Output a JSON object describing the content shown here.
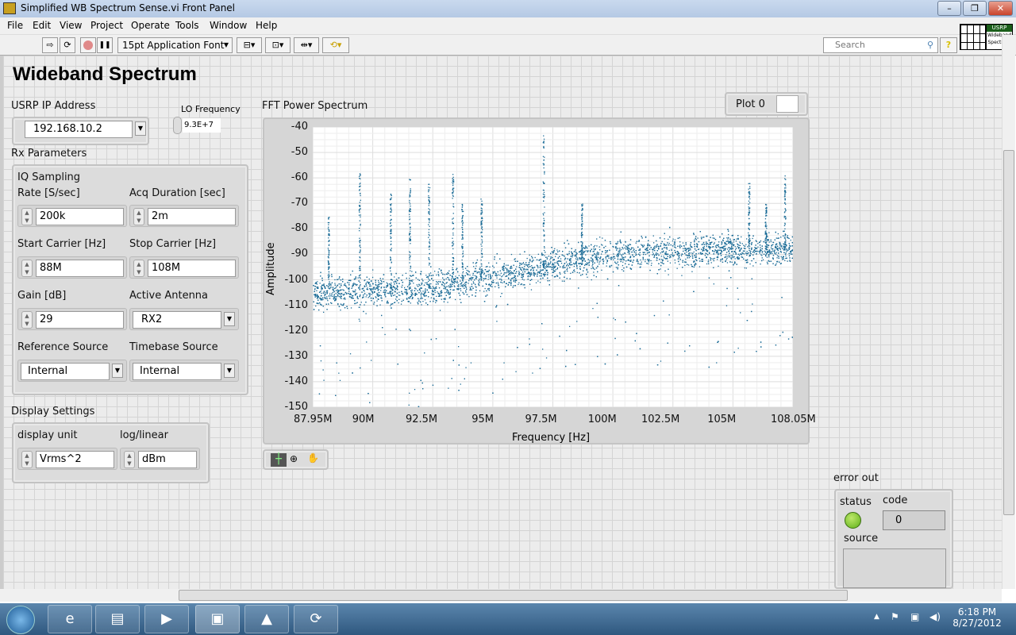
{
  "window": {
    "title": "Simplified WB Spectrum Sense.vi Front Panel",
    "minimize": "–",
    "restore": "❐",
    "close": "✕"
  },
  "menu": [
    "File",
    "Edit",
    "View",
    "Project",
    "Operate",
    "Tools",
    "Window",
    "Help"
  ],
  "toolbar": {
    "font": "15pt Application Font",
    "search_placeholder": "Search"
  },
  "vi_icon": {
    "banner": "USRP",
    "line1": "Wideband",
    "line2": "Spectrum"
  },
  "panel": {
    "title": "Wideband Spectrum",
    "ip": {
      "label": "USRP IP Address",
      "value": "192.168.10.2"
    },
    "lo": {
      "label": "LO Frequency",
      "value": "9.3E+7"
    },
    "rx": {
      "label": "Rx Parameters",
      "iq_label": "IQ Sampling",
      "rate": {
        "label": "Rate [S/sec]",
        "value": "200k"
      },
      "acq": {
        "label": "Acq Duration [sec]",
        "value": "2m"
      },
      "start": {
        "label": "Start Carrier [Hz]",
        "value": "88M"
      },
      "stop": {
        "label": "Stop Carrier [Hz]",
        "value": "108M"
      },
      "gain": {
        "label": "Gain [dB]",
        "value": "29"
      },
      "antenna": {
        "label": "Active Antenna",
        "value": "RX2"
      },
      "ref": {
        "label": "Reference Source",
        "value": "Internal"
      },
      "timebase": {
        "label": "Timebase Source",
        "value": "Internal"
      }
    },
    "display": {
      "label": "Display Settings",
      "unit_label": "display unit",
      "unit_value": "Vrms^2",
      "log_label": "log/linear",
      "log_value": "dBm"
    },
    "error": {
      "label": "error out",
      "status_label": "status",
      "code_label": "code",
      "code_value": "0",
      "source_label": "source",
      "status_color": "#5fb01a"
    }
  },
  "chart_data": {
    "type": "scatter",
    "title": "FFT Power Spectrum",
    "xlabel": "Frequency [Hz]",
    "ylabel": "Amplitude",
    "legend": "Plot 0",
    "legend_placement": "top-right",
    "color": "#1a6b96",
    "grid": true,
    "xlim": [
      87950000,
      108050000
    ],
    "ylim": [
      -150,
      -40
    ],
    "xticks": [
      "87.95M",
      "90M",
      "92.5M",
      "95M",
      "97.5M",
      "100M",
      "102.5M",
      "105M",
      "108.05M"
    ],
    "xtick_values": [
      87950000,
      90000000,
      92500000,
      95000000,
      97500000,
      100000000,
      102500000,
      105000000,
      108050000
    ],
    "yticks": [
      "-40",
      "-50",
      "-60",
      "-70",
      "-80",
      "-90",
      "-100",
      "-110",
      "-120",
      "-130",
      "-140",
      "-150"
    ],
    "noise_floor": [
      {
        "x": 87950000,
        "y": -105
      },
      {
        "x": 93000000,
        "y": -103
      },
      {
        "x": 97500000,
        "y": -95
      },
      {
        "x": 100000000,
        "y": -90
      },
      {
        "x": 105000000,
        "y": -88
      },
      {
        "x": 108050000,
        "y": -88
      }
    ],
    "peaks": [
      {
        "x": 88600000,
        "y": -75
      },
      {
        "x": 89900000,
        "y": -58
      },
      {
        "x": 91200000,
        "y": -65
      },
      {
        "x": 92000000,
        "y": -60
      },
      {
        "x": 92800000,
        "y": -62
      },
      {
        "x": 93800000,
        "y": -57
      },
      {
        "x": 94200000,
        "y": -70
      },
      {
        "x": 95000000,
        "y": -68
      },
      {
        "x": 97600000,
        "y": -43
      },
      {
        "x": 99200000,
        "y": -70
      },
      {
        "x": 106200000,
        "y": -62
      },
      {
        "x": 106900000,
        "y": -70
      },
      {
        "x": 107700000,
        "y": -59
      }
    ]
  },
  "taskbar": {
    "time": "6:18 PM",
    "date": "8/27/2012"
  }
}
